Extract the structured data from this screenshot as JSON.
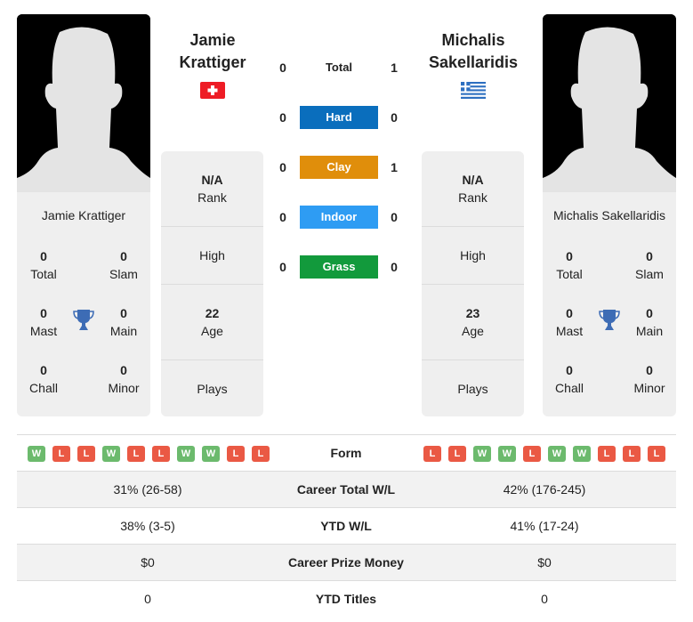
{
  "players": [
    {
      "name_line1": "Jamie",
      "name_line2": "Krattiger",
      "full_name": "Jamie Krattiger",
      "flag_icon": "switzerland-flag-icon",
      "titles": {
        "total": "0",
        "slam": "0",
        "mast": "0",
        "main": "0",
        "chall": "0",
        "minor": "0"
      },
      "info": {
        "rank_value": "N/A",
        "rank_label": "Rank",
        "high_label": "High",
        "age_value": "22",
        "age_label": "Age",
        "plays_label": "Plays"
      }
    },
    {
      "name_line1": "Michalis",
      "name_line2": "Sakellaridis",
      "full_name": "Michalis Sakellaridis",
      "flag_icon": "greece-flag-icon",
      "titles": {
        "total": "0",
        "slam": "0",
        "mast": "0",
        "main": "0",
        "chall": "0",
        "minor": "0"
      },
      "info": {
        "rank_value": "N/A",
        "rank_label": "Rank",
        "high_label": "High",
        "age_value": "23",
        "age_label": "Age",
        "plays_label": "Plays"
      }
    }
  ],
  "title_labels": {
    "total": "Total",
    "slam": "Slam",
    "mast": "Mast",
    "main": "Main",
    "chall": "Chall",
    "minor": "Minor"
  },
  "h2h": [
    {
      "label": "Total",
      "left": "0",
      "right": "1",
      "color": ""
    },
    {
      "label": "Hard",
      "left": "0",
      "right": "0",
      "color": "#0a6ebd"
    },
    {
      "label": "Clay",
      "left": "0",
      "right": "1",
      "color": "#e08e0b"
    },
    {
      "label": "Indoor",
      "left": "0",
      "right": "0",
      "color": "#2e9cf3"
    },
    {
      "label": "Grass",
      "left": "0",
      "right": "0",
      "color": "#129a3c"
    }
  ],
  "form": {
    "label": "Form",
    "left": [
      "W",
      "L",
      "L",
      "W",
      "L",
      "L",
      "W",
      "W",
      "L",
      "L"
    ],
    "right": [
      "L",
      "L",
      "W",
      "W",
      "L",
      "W",
      "W",
      "L",
      "L",
      "L"
    ]
  },
  "stats": [
    {
      "label": "Career Total W/L",
      "left": "31% (26-58)",
      "right": "42% (176-245)"
    },
    {
      "label": "YTD W/L",
      "left": "38% (3-5)",
      "right": "41% (17-24)"
    },
    {
      "label": "Career Prize Money",
      "left": "$0",
      "right": "$0"
    },
    {
      "label": "YTD Titles",
      "left": "0",
      "right": "0"
    }
  ],
  "colors": {
    "win": "#6cba6d",
    "loss": "#ea5944",
    "trophy": "#3d6cb5",
    "card_bg": "#efefef"
  }
}
